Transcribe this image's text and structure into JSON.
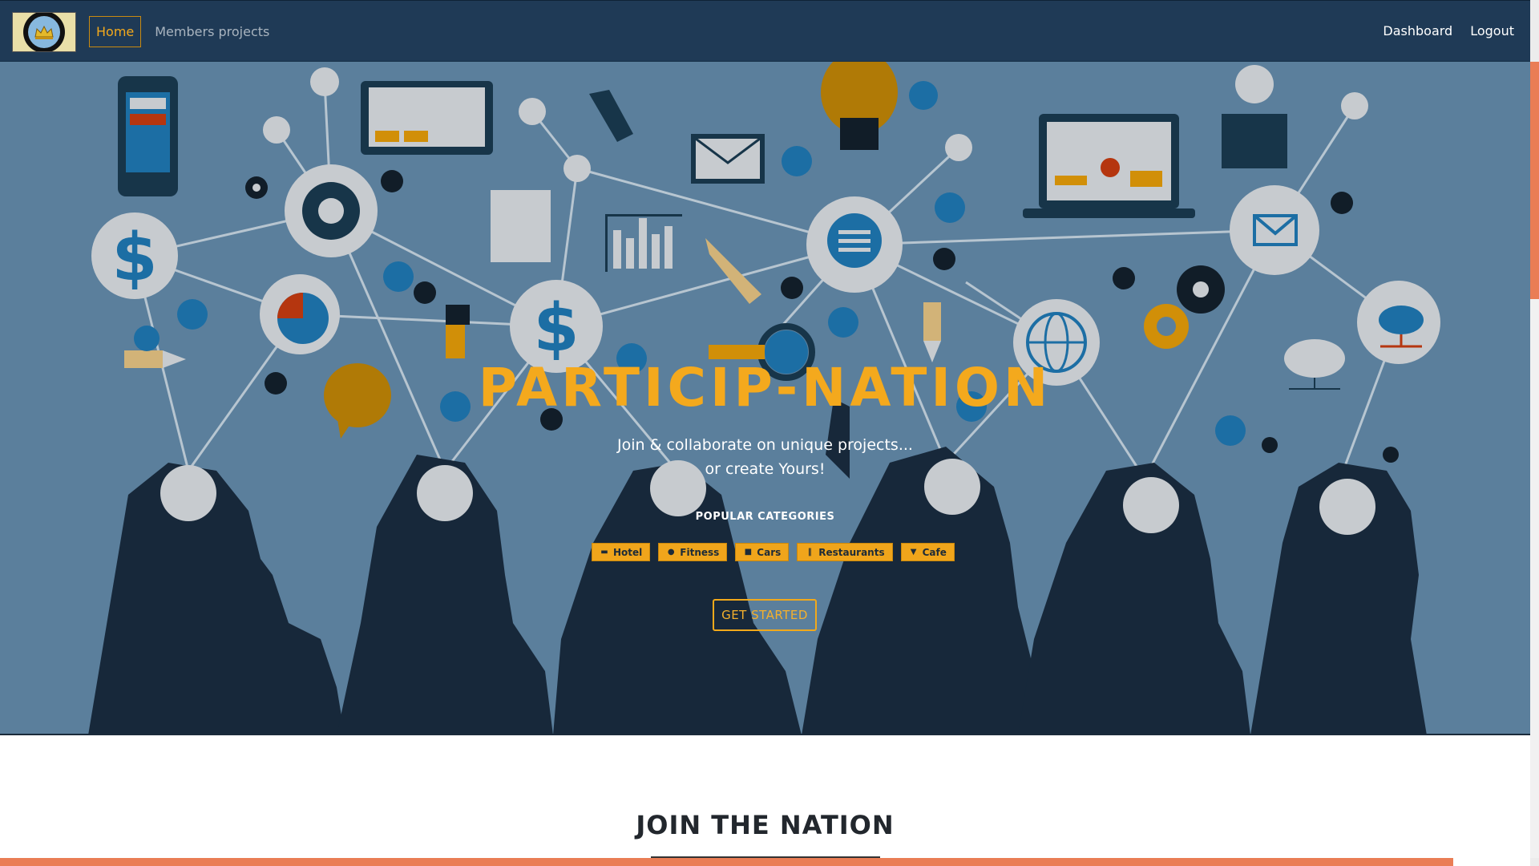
{
  "navbar": {
    "logo": "logo",
    "links": [
      {
        "label": "Home",
        "active": true
      },
      {
        "label": "Members projects",
        "active": false
      }
    ],
    "right_links": [
      "Dashboard",
      "Logout"
    ]
  },
  "hero": {
    "title": "PARTICIP-NATION",
    "tagline_line1": "Join & collaborate on unique projects...",
    "tagline_line2": "or create Yours!",
    "categories_heading": "POPULAR CATEGORIES",
    "categories": [
      {
        "label": "Hotel",
        "icon": "bed-icon"
      },
      {
        "label": "Fitness",
        "icon": "user-icon"
      },
      {
        "label": "Cars",
        "icon": "car-icon"
      },
      {
        "label": "Restaurants",
        "icon": "cutlery-icon"
      },
      {
        "label": "Cafe",
        "icon": "coffee-icon"
      }
    ],
    "cta_label": "GET STARTED"
  },
  "section": {
    "title": "JOIN THE NATION"
  },
  "colors": {
    "nav_bg": "#1f3a56",
    "hero_bg": "#5b7f9c",
    "accent": "#f4a91d",
    "silhouette": "#17283a",
    "scroll_accent": "#ea7d55"
  }
}
